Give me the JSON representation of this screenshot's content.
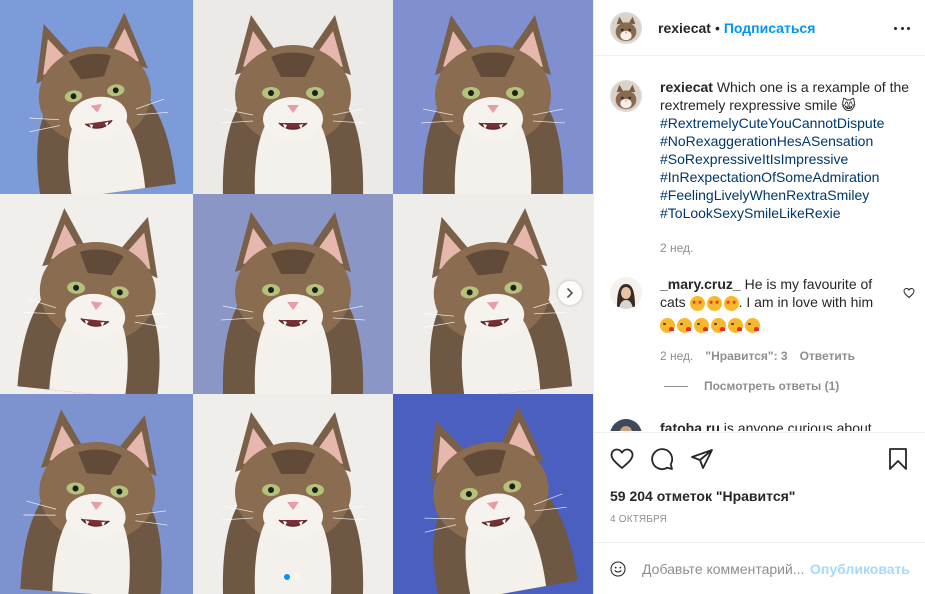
{
  "post": {
    "username": "rexiecat",
    "follow_label": "Подписаться",
    "header_separator": "•"
  },
  "caption": {
    "username": "rexiecat",
    "text": "Which one is a rexample of the rextremely rexpressive smile 😸",
    "hashtags": [
      "#RextremelyCuteYouCannotDispute",
      "#NoRexaggerationHesASensation",
      "#SoRexpressiveItIsImpressive",
      "#InRexpectationOfSomeAdmiration",
      "#FeelingLivelyWhenRextraSmiley",
      "#ToLookSexySmileLikeRexie"
    ],
    "time": "2 нед."
  },
  "comment": {
    "username": "_mary.cruz_",
    "text_part1": "He is my favourite of cats",
    "text_part2": ". I am in love with him",
    "time": "2 нед.",
    "likes": "\"Нравится\": 3",
    "reply": "Ответить",
    "view_replies": "Посмотреть ответы (1)"
  },
  "comment2": {
    "username": "fatoba.ru",
    "text": "is anyone curious about"
  },
  "stats": {
    "likes": "59 204 отметок \"Нравится\"",
    "date": "4 ОКТЯБРЯ"
  },
  "composer": {
    "placeholder": "Добавьте комментарий...",
    "publish": "Опубликовать"
  },
  "colors": {
    "accent": "#0095f6",
    "hashtag": "#00376b",
    "muted": "#8e8e8e",
    "border": "#efefef"
  },
  "media": {
    "photo_count": 9,
    "carousel_pages": 2,
    "carousel_active": 0,
    "icons": [
      "chevron-right-icon",
      "heart-icon",
      "comment-icon",
      "share-icon",
      "bookmark-icon",
      "smile-icon",
      "more-icon"
    ]
  }
}
